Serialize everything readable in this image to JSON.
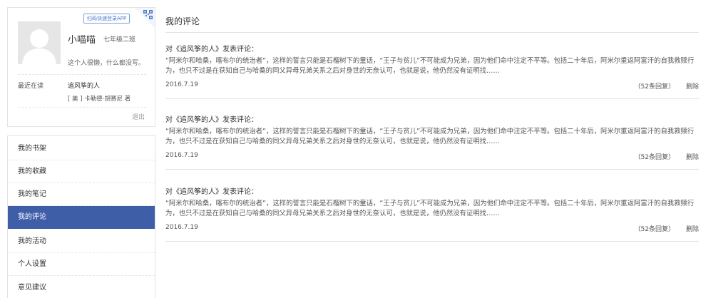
{
  "profile": {
    "qr_badge": "扫码快速登录APP",
    "name": "小喵喵",
    "grade": "七年级二班",
    "signature": "这个人很懒，什么都没写。",
    "recent_label": "最近在读",
    "recent_book_title": "追风筝的人",
    "recent_book_author": "[ 美 ] 卡勒德·胡赛尼  著",
    "logout": "退出"
  },
  "menu": {
    "items": [
      {
        "label": "我的书架"
      },
      {
        "label": "我的收藏"
      },
      {
        "label": "我的笔记"
      },
      {
        "label": "我的评论",
        "active": true
      },
      {
        "label": "我的活动"
      },
      {
        "label": "个人设置"
      },
      {
        "label": "意见建议"
      }
    ]
  },
  "main": {
    "title": "我的评论",
    "comments": [
      {
        "heading": "对《追风筝的人》发表评论：",
        "body": "“阿米尔和哈桑，喀布尔的统治者”，这样的誓言只能是石榴树下的童话，“王子与贫儿”不可能成为兄弟，因为他们命中注定不平等。包括二十年后，阿米尔重返阿富汗的自我救赎行为，也只不过是在获知自己与哈桑的同父异母兄弟关系之后对身世的无奈认可，也就是说，他仍然没有证明找……",
        "date": "2016.7.19",
        "replies": "（52条回复）",
        "delete": "删除"
      },
      {
        "heading": "对《追风筝的人》发表评论：",
        "body": "“阿米尔和哈桑，喀布尔的统治者”，这样的誓言只能是石榴树下的童话，“王子与贫儿”不可能成为兄弟，因为他们命中注定不平等。包括二十年后，阿米尔重返阿富汗的自我救赎行为，也只不过是在获知自己与哈桑的同父异母兄弟关系之后对身世的无奈认可，也就是说，他仍然没有证明找……",
        "date": "2016.7.19",
        "replies": "（52条回复）",
        "delete": "删除"
      },
      {
        "heading": "对《追风筝的人》发表评论：",
        "body": "“阿米尔和哈桑，喀布尔的统治者”，这样的誓言只能是石榴树下的童话，“王子与贫儿”不可能成为兄弟，因为他们命中注定不平等。包括二十年后，阿米尔重返阿富汗的自我救赎行为，也只不过是在获知自己与哈桑的同父异母兄弟关系之后对身世的无奈认可，也就是说，他仍然没有证明找……",
        "date": "2016.7.19",
        "replies": "（52条回复）",
        "delete": "删除"
      }
    ]
  },
  "icons": {
    "qr": "qr-code-icon",
    "avatar": "default-avatar-icon"
  },
  "colors": {
    "accent": "#3f5ea8",
    "badge": "#4a78c6"
  }
}
